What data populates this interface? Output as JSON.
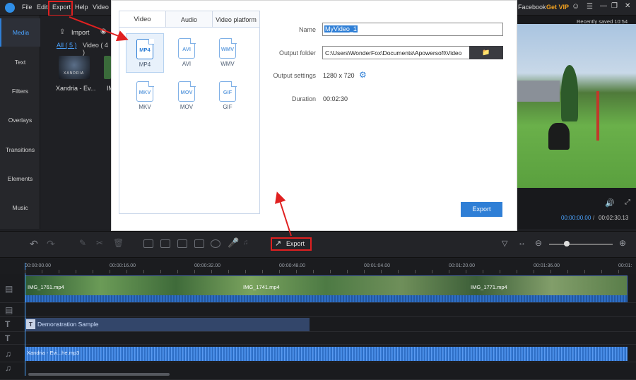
{
  "menubar": {
    "items": [
      "File",
      "Edit",
      "Export",
      "Help",
      "Video I"
    ],
    "right": {
      "facebook": "Facebook",
      "getvip": "Get VIP"
    }
  },
  "left_tabs": [
    "Media",
    "Text",
    "Filters",
    "Overlays",
    "Transitions",
    "Elements",
    "Music"
  ],
  "media_panel": {
    "import_label": "Import",
    "filters": {
      "all": "All ( 5 )",
      "video": "Video ( 4 )"
    },
    "thumb_label": "Xandria - Ev...",
    "thumb_label2": "IM",
    "thumb_brand": "XANDRIA"
  },
  "dialog": {
    "tabs": [
      "Video",
      "Audio",
      "Video platform"
    ],
    "formats": [
      {
        "label": "MP4",
        "selected": true
      },
      {
        "label": "AVI",
        "selected": false
      },
      {
        "label": "WMV",
        "selected": false
      },
      {
        "label": "MKV",
        "selected": false
      },
      {
        "label": "MOV",
        "selected": false
      },
      {
        "label": "GIF",
        "selected": false
      }
    ],
    "name_label": "Name",
    "name_value": "MyVideo_1",
    "folder_label": "Output folder",
    "folder_value": "C:\\Users\\WonderFox\\Documents\\Apowersoft\\Video",
    "settings_label": "Output settings",
    "settings_value": "1280 x 720",
    "duration_label": "Duration",
    "duration_value": "00:02:30",
    "export_button": "Export"
  },
  "preview": {
    "saved": "Recently saved 10:54",
    "time_current": "00:00:00.00",
    "time_sep": "/",
    "time_total": "00:02:30.13"
  },
  "toolbar": {
    "export_label": "Export"
  },
  "timeline": {
    "ruler": [
      "00:00:00.00",
      "00:00:16.00",
      "00:00:32.00",
      "00:00:48.00",
      "00:01:04.00",
      "00:01:20.00",
      "00:01:36.00",
      "00:01:"
    ],
    "clips": {
      "v1": "IMG_1761.mp4",
      "v2": "IMG_1741.mp4",
      "v3": "IMG_1771.mp4"
    },
    "text_clip": "Demonstration Sample",
    "audio_clip": "Xandria - Evi...he.mp3"
  },
  "colors": {
    "accent": "#2f7fd6",
    "highlight": "#e02020",
    "getvip": "#f0a020"
  }
}
